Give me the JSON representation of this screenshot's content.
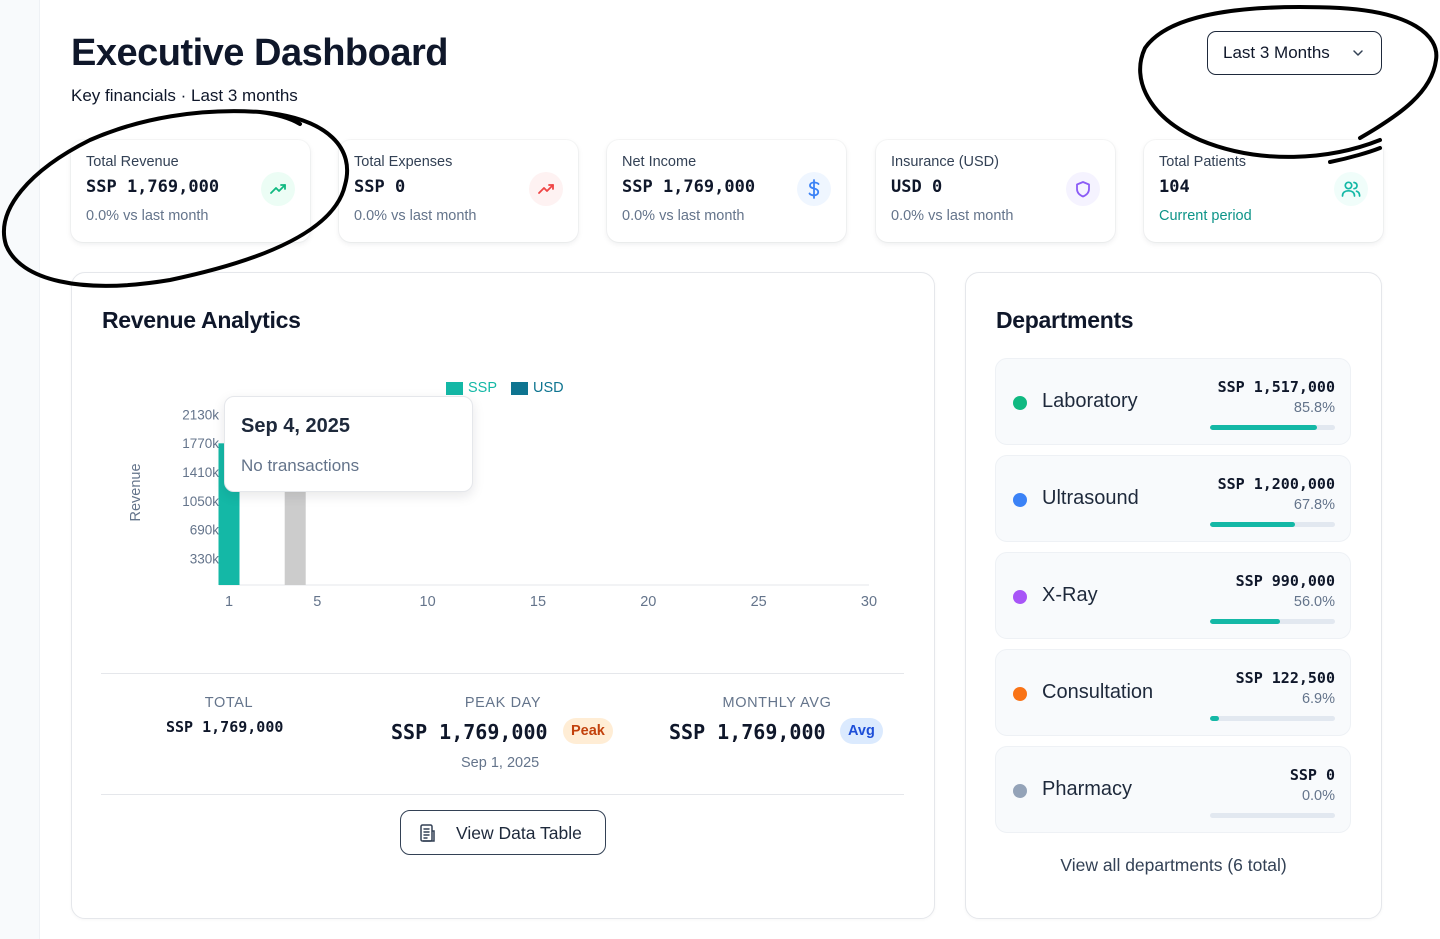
{
  "header": {
    "title": "Executive Dashboard",
    "subtitle": "Key financials · Last 3 months",
    "range_select": "Last 3 Months"
  },
  "kpis": [
    {
      "label": "Total Revenue",
      "value": "SSP 1,769,000",
      "delta": "0.0% vs last month",
      "icon": "trending-up-icon",
      "color": "#10b981"
    },
    {
      "label": "Total Expenses",
      "value": "SSP 0",
      "delta": "0.0% vs last month",
      "icon": "trending-up-icon",
      "color": "#ef4444"
    },
    {
      "label": "Net Income",
      "value": "SSP 1,769,000",
      "delta": "0.0% vs last month",
      "icon": "dollar-icon",
      "color": "#3b82f6"
    },
    {
      "label": "Insurance (USD)",
      "value": "USD 0",
      "delta": "0.0% vs last month",
      "icon": "shield-icon",
      "color": "#8b5cf6"
    },
    {
      "label": "Total Patients",
      "value": "104",
      "delta": "Current period",
      "icon": "users-icon",
      "color": "#14b8a6"
    }
  ],
  "revenue": {
    "title": "Revenue Analytics",
    "tooltip": {
      "date": "Sep 4, 2025",
      "message": "No transactions"
    },
    "stats": {
      "total_label": "TOTAL",
      "total_value": "SSP 1,769,000",
      "peak_label": "PEAK DAY",
      "peak_value": "SSP 1,769,000",
      "peak_badge": "Peak",
      "peak_date": "Sep 1, 2025",
      "avg_label": "MONTHLY AVG",
      "avg_value": "SSP 1,769,000",
      "avg_badge": "Avg"
    },
    "view_table_button": "View Data Table"
  },
  "chart_data": {
    "type": "bar",
    "ylabel": "Revenue",
    "legend": [
      "SSP",
      "USD"
    ],
    "colors": {
      "SSP": "#14b8a6",
      "USD": "#0e7490",
      "highlight": "#cccccc"
    },
    "x_ticks": [
      "1",
      "5",
      "10",
      "15",
      "20",
      "25",
      "30"
    ],
    "y_ticks": [
      "330k",
      "690k",
      "1050k",
      "1410k",
      "1770k",
      "2130k"
    ],
    "xlim": [
      1,
      30
    ],
    "ylim": [
      0,
      2310
    ],
    "series": [
      {
        "name": "SSP",
        "x": [
          1
        ],
        "values": [
          1769
        ]
      }
    ],
    "highlight": {
      "x": 4,
      "value": 1769
    },
    "legend_position": "top"
  },
  "departments": {
    "title": "Departments",
    "items": [
      {
        "name": "Laboratory",
        "amount": "SSP 1,517,000",
        "pct": "85.8%",
        "share": 0.858,
        "color": "#10b981"
      },
      {
        "name": "Ultrasound",
        "amount": "SSP 1,200,000",
        "pct": "67.8%",
        "share": 0.678,
        "color": "#3b82f6"
      },
      {
        "name": "X-Ray",
        "amount": "SSP 990,000",
        "pct": "56.0%",
        "share": 0.56,
        "color": "#a855f7"
      },
      {
        "name": "Consultation",
        "amount": "SSP 122,500",
        "pct": "6.9%",
        "share": 0.069,
        "color": "#f97316"
      },
      {
        "name": "Pharmacy",
        "amount": "SSP 0",
        "pct": "0.0%",
        "share": 0.0,
        "color": "#94a3b8"
      }
    ],
    "view_all": "View all departments (6 total)"
  }
}
